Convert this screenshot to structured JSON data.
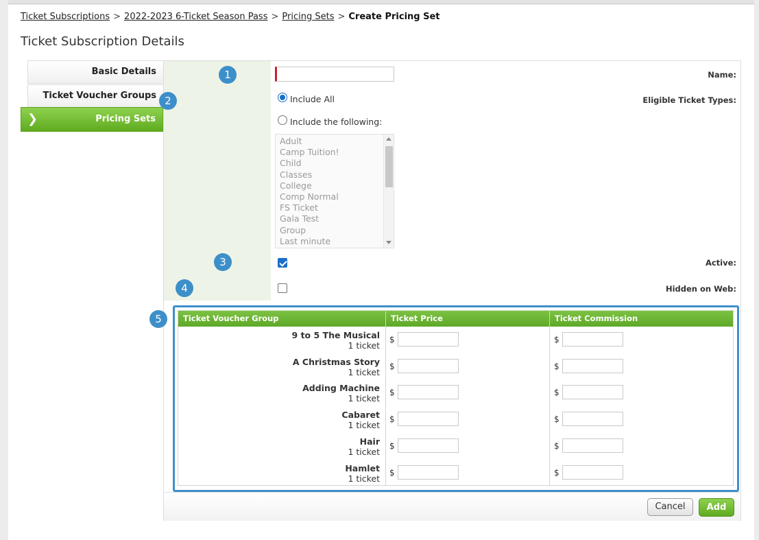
{
  "breadcrumb": {
    "items": [
      "Ticket Subscriptions",
      "2022-2023 6-Ticket Season Pass",
      "Pricing Sets"
    ],
    "current": "Create Pricing Set",
    "separator": ">"
  },
  "page_title": "Ticket Subscription Details",
  "tabs": [
    {
      "label": "Basic Details"
    },
    {
      "label": "Ticket Voucher Groups"
    },
    {
      "label": "Pricing Sets",
      "active": true
    }
  ],
  "form": {
    "name": {
      "label": "Name:",
      "value": ""
    },
    "eligible": {
      "label": "Eligible Ticket Types:",
      "option_all": "Include All",
      "option_following": "Include the following:",
      "selected": "Include All",
      "ticket_types": [
        "Adult",
        "Camp Tuition!",
        "Child",
        "Classes",
        "College",
        "Comp Normal",
        "FS Ticket",
        "Gala Test",
        "Group",
        "Last minute"
      ]
    },
    "active": {
      "label": "Active:",
      "checked": true
    },
    "hidden": {
      "label": "Hidden on Web:",
      "checked": false
    }
  },
  "badges": [
    "1",
    "2",
    "3",
    "4",
    "5"
  ],
  "voucher_table": {
    "headers": [
      "Ticket Voucher Group",
      "Ticket Price",
      "Ticket Commission"
    ],
    "currency": "$",
    "rows": [
      {
        "name": "9 to 5 The Musical",
        "sub": "1 ticket",
        "price": "",
        "commission": ""
      },
      {
        "name": "A Christmas Story",
        "sub": "1 ticket",
        "price": "",
        "commission": ""
      },
      {
        "name": "Adding Machine",
        "sub": "1 ticket",
        "price": "",
        "commission": ""
      },
      {
        "name": "Cabaret",
        "sub": "1 ticket",
        "price": "",
        "commission": ""
      },
      {
        "name": "Hair",
        "sub": "1 ticket",
        "price": "",
        "commission": ""
      },
      {
        "name": "Hamlet",
        "sub": "1 ticket",
        "price": "",
        "commission": ""
      }
    ]
  },
  "buttons": {
    "cancel": "Cancel",
    "add": "Add"
  },
  "colors": {
    "accent_green": "#6cb52f",
    "highlight_blue": "#3d8fc9",
    "required_red": "#c1272d"
  }
}
